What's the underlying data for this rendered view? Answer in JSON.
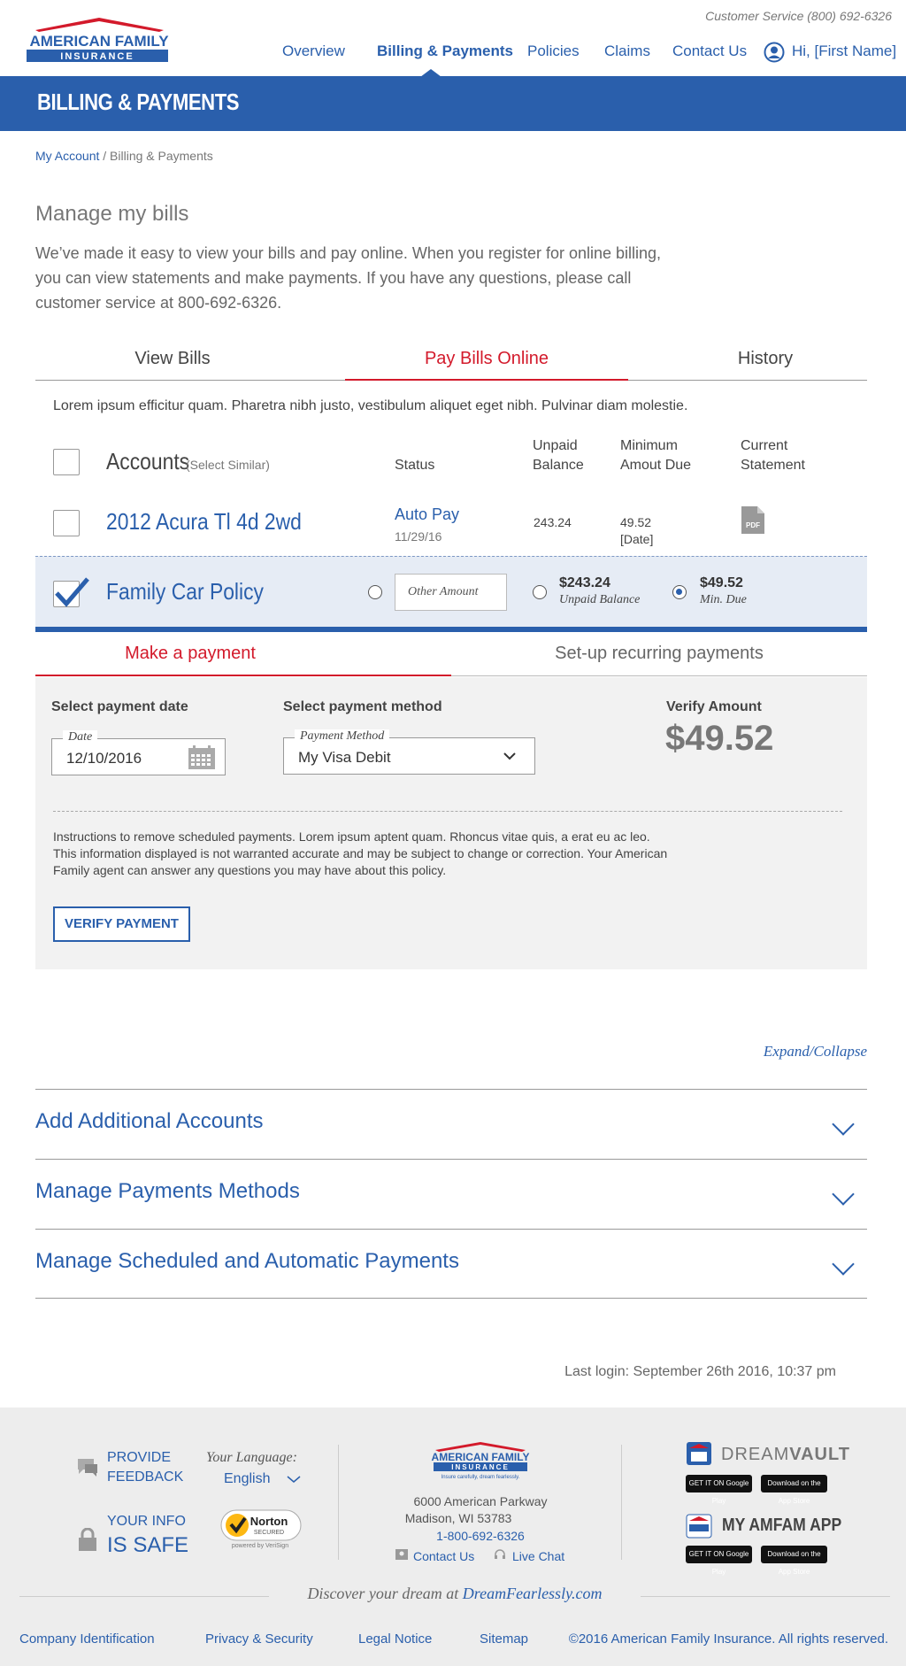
{
  "header": {
    "customer_service": "Customer Service (800) 692-6326",
    "logo_line1": "AMERICAN FAMILY",
    "logo_line2": "INSURANCE",
    "nav": [
      {
        "label": "Overview"
      },
      {
        "label": "Billing & Payments"
      },
      {
        "label": "Policies"
      },
      {
        "label": "Claims"
      },
      {
        "label": "Contact Us"
      }
    ],
    "greeting": "Hi, [First Name]"
  },
  "banner": {
    "title": "BILLING & PAYMENTS"
  },
  "breadcrumb": {
    "root": "My Account",
    "separator": " / ",
    "current": "Billing & Payments"
  },
  "intro": {
    "heading": "Manage my bills",
    "body": "We’ve made it easy to view your bills and pay online. When you register for online billing, you can view statements and make payments. If you have any questions, please call customer service at 800-692-6326."
  },
  "tabs": [
    {
      "label": "View Bills"
    },
    {
      "label": "Pay Bills Online"
    },
    {
      "label": "History"
    }
  ],
  "lorem": "Lorem ipsum efficitur quam. Pharetra nibh justo, vestibulum aliquet eget nibh. Pulvinar diam molestie.",
  "table": {
    "accounts_label": "Accounts",
    "select_similar": "(Select Similar)",
    "col_status": "Status",
    "col_unpaid_1": "Unpaid",
    "col_unpaid_2": "Balance",
    "col_min_1": "Minimum",
    "col_min_2": "Amout Due",
    "col_stmt_1": "Current",
    "col_stmt_2": "Statement",
    "row1": {
      "name": "2012 Acura Tl 4d 2wd",
      "status": "Auto Pay",
      "status_date": "11/29/16",
      "unpaid": "243.24",
      "min_due": "49.52",
      "min_date": "[Date]",
      "pdf": "PDF"
    },
    "row2": {
      "name": "Family Car Policy",
      "other_amount_placeholder": "Other Amount",
      "unpaid_amount": "$243.24",
      "unpaid_label": "Unpaid Balance",
      "min_amount": "$49.52",
      "min_label": "Min. Due"
    }
  },
  "payment": {
    "tab_make": "Make a payment",
    "tab_recurring": "Set-up recurring payments",
    "date_label": "Select payment date",
    "date_legend": "Date",
    "date_value": "12/10/2016",
    "method_label": "Select payment method",
    "method_legend": "Payment Method",
    "method_value": "My Visa Debit",
    "verify_label": "Verify Amount",
    "verify_amount": "$49.52",
    "instructions": "Instructions to remove scheduled payments. Lorem ipsum aptent quam. Rhoncus vitae quis, a erat eu ac leo. This information displayed is not warranted accurate and may be subject to change or correction. Your American Family agent can answer any questions you may have about this policy.",
    "verify_button": "VERIFY PAYMENT"
  },
  "expand_collapse": "Expand/Collapse",
  "accordions": [
    {
      "title": "Add Additional Accounts"
    },
    {
      "title": "Manage Payments Methods"
    },
    {
      "title": "Manage Scheduled and Automatic Payments"
    }
  ],
  "last_login": "Last login: September 26th 2016, 10:37 pm",
  "footer": {
    "feedback_1": "PROVIDE",
    "feedback_2": "FEEDBACK",
    "language_label": "Your Language:",
    "language_value": "English",
    "info_1": "YOUR INFO",
    "info_2": "IS SAFE",
    "norton_1": "Norton",
    "norton_2": "SECURED",
    "norton_3": "powered by VeriSign",
    "logo_line1": "AMERICAN FAMILY",
    "logo_line2": "INSURANCE",
    "tagline": "Insure carefully, dream fearlessly.",
    "address_1": "6000 American Parkway",
    "address_2": "Madison, WI 53783",
    "phone": "1-800-692-6326",
    "contact_us": "Contact Us",
    "live_chat": "Live Chat",
    "dreamvault_1": "DREAM",
    "dreamvault_2": "VAULT",
    "app_title": "MY AMFAM APP",
    "google_play": "GET IT ON Google Play",
    "app_store": "Download on the App Store",
    "discover_prefix": "Discover your dream at ",
    "discover_link": "DreamFearlessly.com",
    "links": [
      {
        "label": "Company Identification"
      },
      {
        "label": "Privacy & Security"
      },
      {
        "label": "Legal Notice"
      },
      {
        "label": "Sitemap"
      }
    ],
    "copyright": "©2016 American Family Insurance. All rights reserved."
  },
  "colors": {
    "brand_blue": "#2a5fac",
    "accent_red": "#d31a2b",
    "footer_bg": "#ededed"
  }
}
